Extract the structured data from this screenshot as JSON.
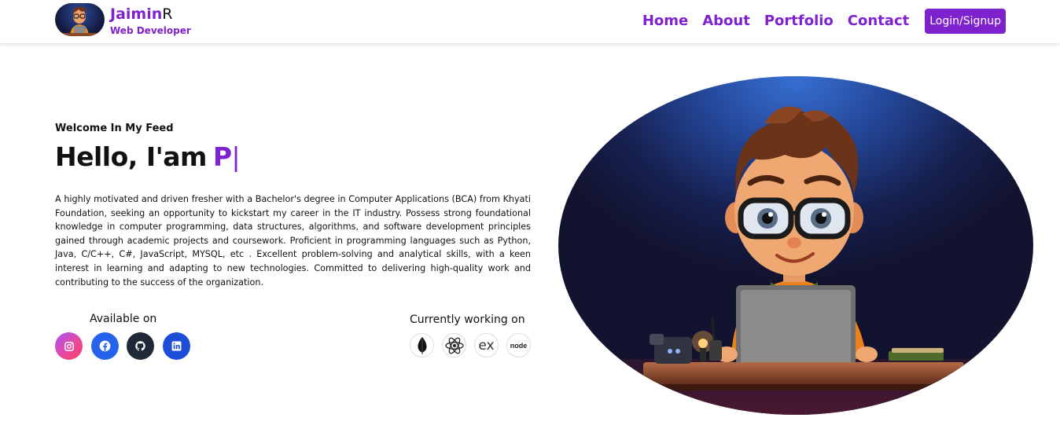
{
  "brand": {
    "name_first": "Jaimin",
    "name_last": "R",
    "role": "Web Developer"
  },
  "nav": {
    "links": [
      "Home",
      "About",
      "Portfolio",
      "Contact"
    ],
    "login_label": "Login/Signup"
  },
  "hero": {
    "welcome": "Welcome In My Feed",
    "greeting": "Hello, I'am",
    "typed_text": "P",
    "cursor": "|",
    "bio": "A highly motivated and driven fresher with a Bachelor's degree in Computer Applications (BCA) from Khyati Foundation, seeking an opportunity to kickstart my career in the IT industry. Possess strong foundational knowledge in computer programming, data structures, algorithms, and software development principles gained through academic projects and coursework. Proficient in programming languages such as Python, Java, C/C++, C#, JavaScript, MYSQL, etc . Excellent problem-solving and analytical skills, with a keen interest in learning and adapting to new technologies. Committed to delivering high-quality work and contributing to the success of the organization."
  },
  "available": {
    "label": "Available on",
    "icons": [
      "instagram-icon",
      "facebook-icon",
      "github-icon",
      "linkedin-icon"
    ]
  },
  "working": {
    "label": "Currently working on",
    "icons": [
      "mongodb-icon",
      "react-icon",
      "express-icon",
      "nodejs-icon"
    ],
    "express_text": "ex",
    "node_text": "node"
  },
  "colors": {
    "accent": "#7e22ce",
    "facebook": "#2563eb",
    "github": "#1f2937",
    "linkedin": "#1d4ed8"
  }
}
